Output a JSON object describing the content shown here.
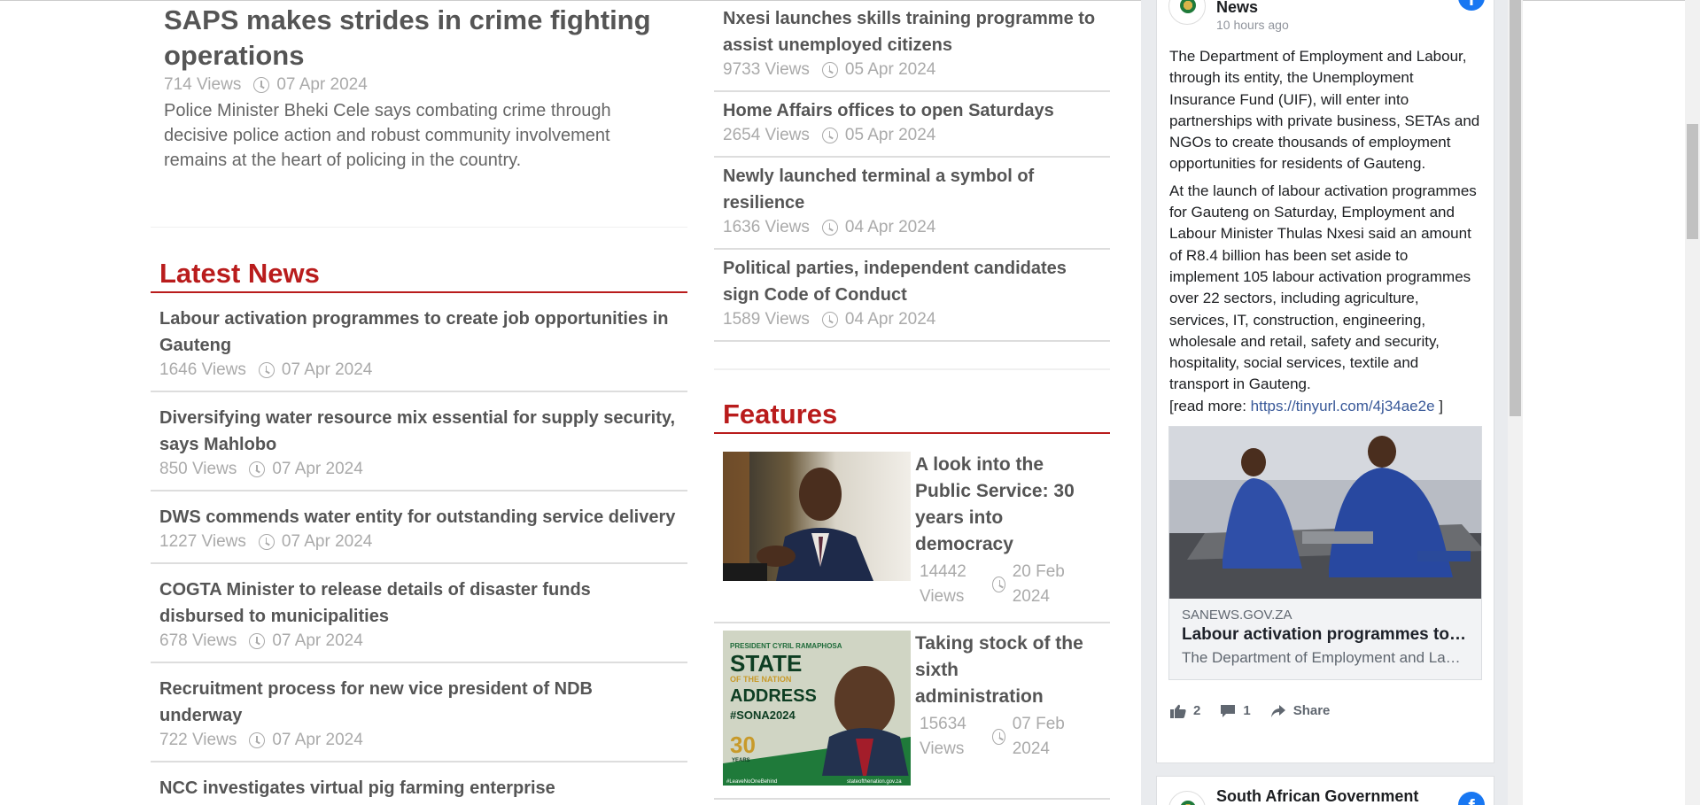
{
  "lead": {
    "title": "SAPS makes strides in crime fighting operations",
    "views": "714 Views",
    "date": "07 Apr 2024",
    "summary": "Police Minister Bheki Cele says combating crime through decisive police action and robust community involvement remains at the heart of policing in the country."
  },
  "latest_news": {
    "heading": "Latest News",
    "items": [
      {
        "title": "Labour activation programmes to create job opportunities in Gauteng",
        "views": "1646 Views",
        "date": "07 Apr 2024"
      },
      {
        "title": "Diversifying water resource mix essential for supply security, says Mahlobo",
        "views": "850 Views",
        "date": "07 Apr 2024"
      },
      {
        "title": "DWS commends water entity for outstanding service delivery",
        "views": "1227 Views",
        "date": "07 Apr 2024"
      },
      {
        "title": "COGTA Minister to release details of disaster funds disbursed to municipalities",
        "views": "678 Views",
        "date": "07 Apr 2024"
      },
      {
        "title": "Recruitment process for new vice president of NDB underway",
        "views": "722 Views",
        "date": "07 Apr 2024"
      },
      {
        "title": "NCC investigates virtual pig farming enterprise",
        "views": "",
        "date": ""
      }
    ]
  },
  "middle_news": {
    "items": [
      {
        "title": "Nxesi launches skills training programme to assist unemployed citizens",
        "views": "9733 Views",
        "date": "05 Apr 2024"
      },
      {
        "title": "Home Affairs offices to open Saturdays",
        "views": "2654 Views",
        "date": "05 Apr 2024"
      },
      {
        "title": "Newly launched terminal a symbol of resilience",
        "views": "1636 Views",
        "date": "04 Apr 2024"
      },
      {
        "title": "Political parties, independent candidates sign Code of Conduct",
        "views": "1589 Views",
        "date": "04 Apr 2024"
      }
    ]
  },
  "features": {
    "heading": "Features",
    "items": [
      {
        "title": "A look into the Public Service: 30 years into democracy",
        "views": "14442 Views",
        "date": "20 Feb 2024"
      },
      {
        "title": "Taking stock of the sixth administration",
        "views": "15634 Views",
        "date": "07 Feb 2024"
      }
    ],
    "sona_image": {
      "line1": "PRESIDENT CYRIL RAMAPHOSA",
      "line2": "STATE",
      "line3": "OF THE NATION",
      "line4": "ADDRESS",
      "hashtag": "#SONA2024",
      "years": "30",
      "years_label": "YEARS",
      "footer_left": "#LeaveNoOneBehind",
      "footer_right": "stateofthenation.gov.za"
    }
  },
  "facebook": {
    "page_name": "News",
    "time": "10 hours ago",
    "paragraph1": "The Department of Employment and Labour, through its entity, the Unemployment Insurance Fund (UIF), will enter into partnerships with private business, SETAs and NGOs to create thousands of employment opportunities for residents of Gauteng.",
    "paragraph2": "At the launch of labour activation programmes for Gauteng on Saturday, Employment and Labour Minister Thulas Nxesi said an amount of R8.4 billion has been set aside to implement 105 labour activation programmes over 22 sectors, including agriculture, services, IT, construction, engineering, wholesale and retail, safety and security, hospitality, social services, textile and transport in Gauteng.",
    "read_more_prefix": "[read more: ",
    "read_more_link": "https://tinyurl.com/4j34ae2e",
    "read_more_suffix": " ]",
    "link_domain": "SANEWS.GOV.ZA",
    "link_title": "Labour activation programmes to create job opportunities in Gauteng",
    "link_desc": "The Department of Employment and Labour, through its entity",
    "likes": "2",
    "comments": "1",
    "share_label": "Share",
    "next_page_name": "South African Government",
    "logo_letter": "f",
    "accent": "#1877f2"
  },
  "colors": {
    "section_red": "#b91c1c",
    "text": "#555555",
    "meta": "#aaaaaa"
  }
}
